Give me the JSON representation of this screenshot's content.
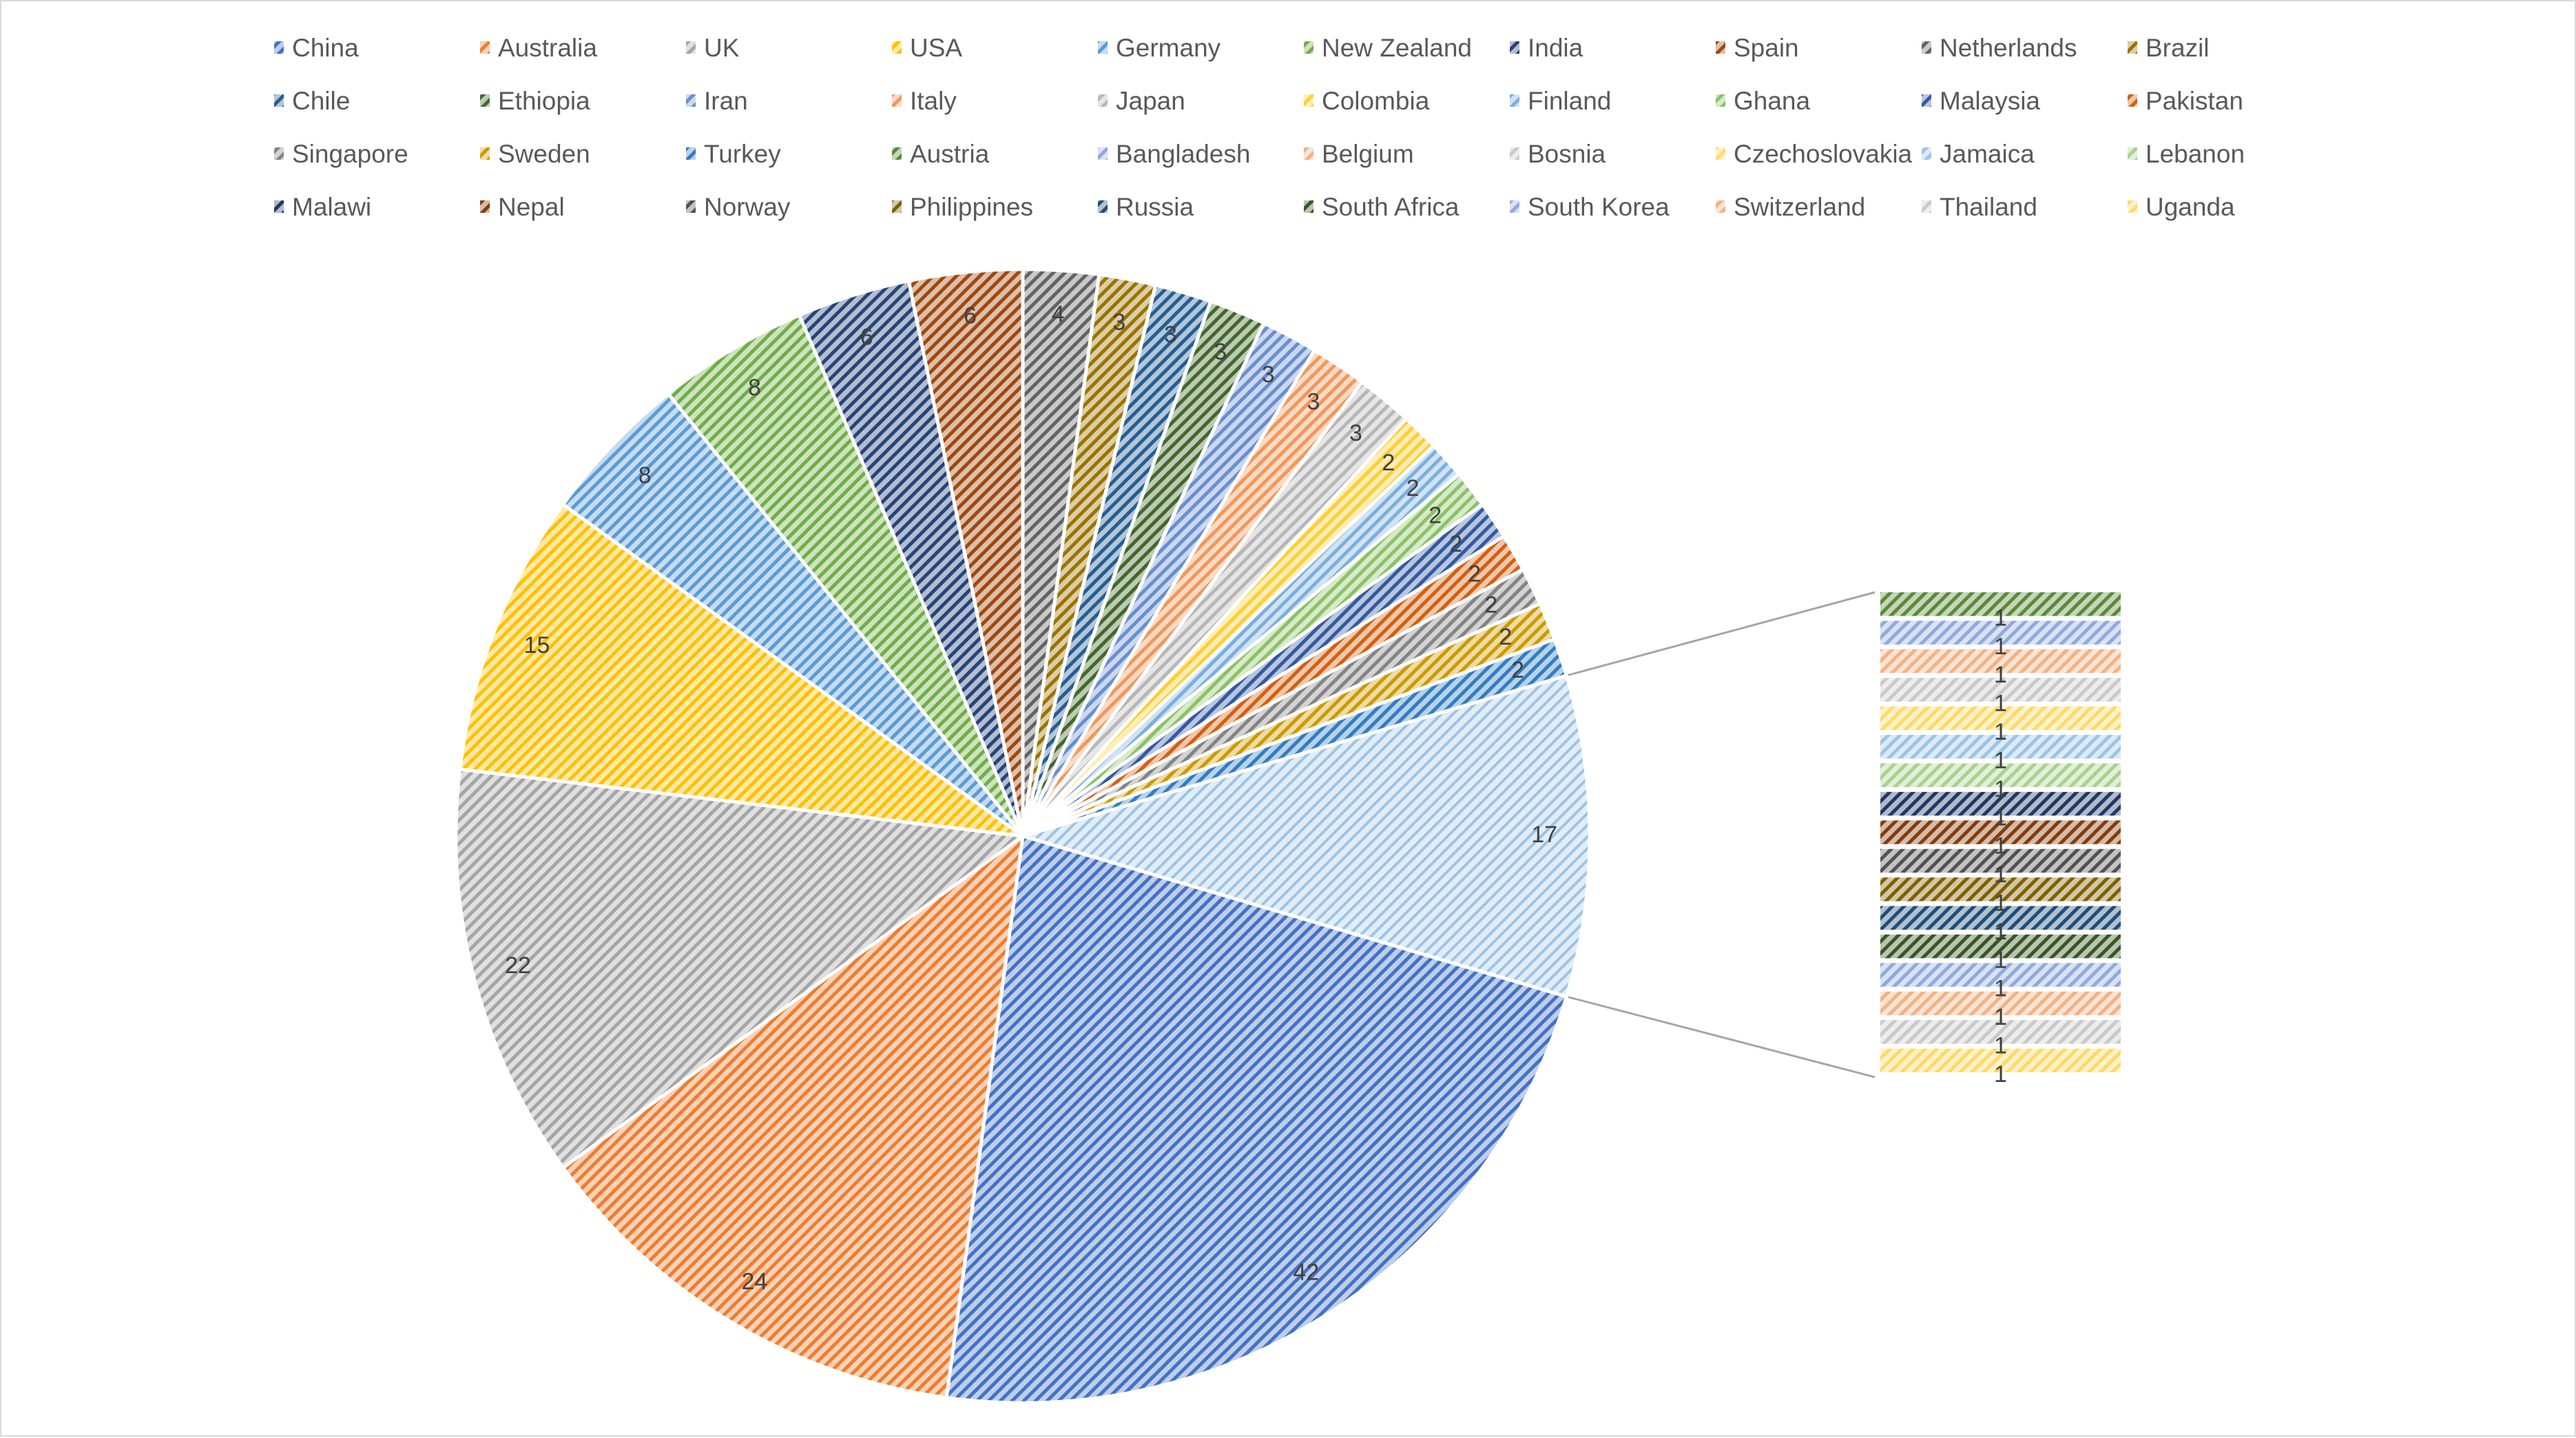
{
  "chart_data": {
    "type": "bar-of-pie",
    "legend_position": "top",
    "categories": [
      "China",
      "Australia",
      "UK",
      "USA",
      "Germany",
      "New Zealand",
      "India",
      "Spain",
      "Netherlands",
      "Brazil",
      "Chile",
      "Ethiopia",
      "Iran",
      "Italy",
      "Japan",
      "Colombia",
      "Finland",
      "Ghana",
      "Malaysia",
      "Pakistan",
      "Singapore",
      "Sweden",
      "Turkey",
      "Austria",
      "Bangladesh",
      "Belgium",
      "Bosnia",
      "Czechoslovakia",
      "Jamaica",
      "Lebanon",
      "Malawi",
      "Nepal",
      "Norway",
      "Philippines",
      "Russia",
      "South Africa",
      "South Korea",
      "Switzerland",
      "Thailand",
      "Uganda"
    ],
    "values": [
      42,
      24,
      22,
      15,
      8,
      8,
      6,
      6,
      4,
      3,
      3,
      3,
      3,
      3,
      3,
      2,
      2,
      2,
      2,
      2,
      2,
      2,
      2,
      1,
      1,
      1,
      1,
      1,
      1,
      1,
      1,
      1,
      1,
      1,
      1,
      1,
      1,
      1,
      1,
      1
    ],
    "colors": [
      "#4472C4",
      "#ED7D31",
      "#A5A5A5",
      "#FFC000",
      "#5B9BD5",
      "#70AD47",
      "#264478",
      "#9E480E",
      "#636363",
      "#997300",
      "#255E91",
      "#43682B",
      "#698ED0",
      "#F1975A",
      "#B7B7B7",
      "#FFCD33",
      "#7CAFDD",
      "#8CC168",
      "#335AA1",
      "#D26012",
      "#848484",
      "#CC9A00",
      "#327DC2",
      "#5A8A39",
      "#8FAADC",
      "#F4B183",
      "#C9C9C9",
      "#FFD966",
      "#9DC3E6",
      "#A9D18E",
      "#203864",
      "#843C0C",
      "#525252",
      "#7F6000",
      "#1F4E79",
      "#385723",
      "#8FAADC",
      "#F4B183",
      "#C9C9C9",
      "#FFD966"
    ],
    "split_into_bar_count": 17,
    "other_slice_value": 17,
    "fill_pattern": "diagonal-hatch"
  }
}
